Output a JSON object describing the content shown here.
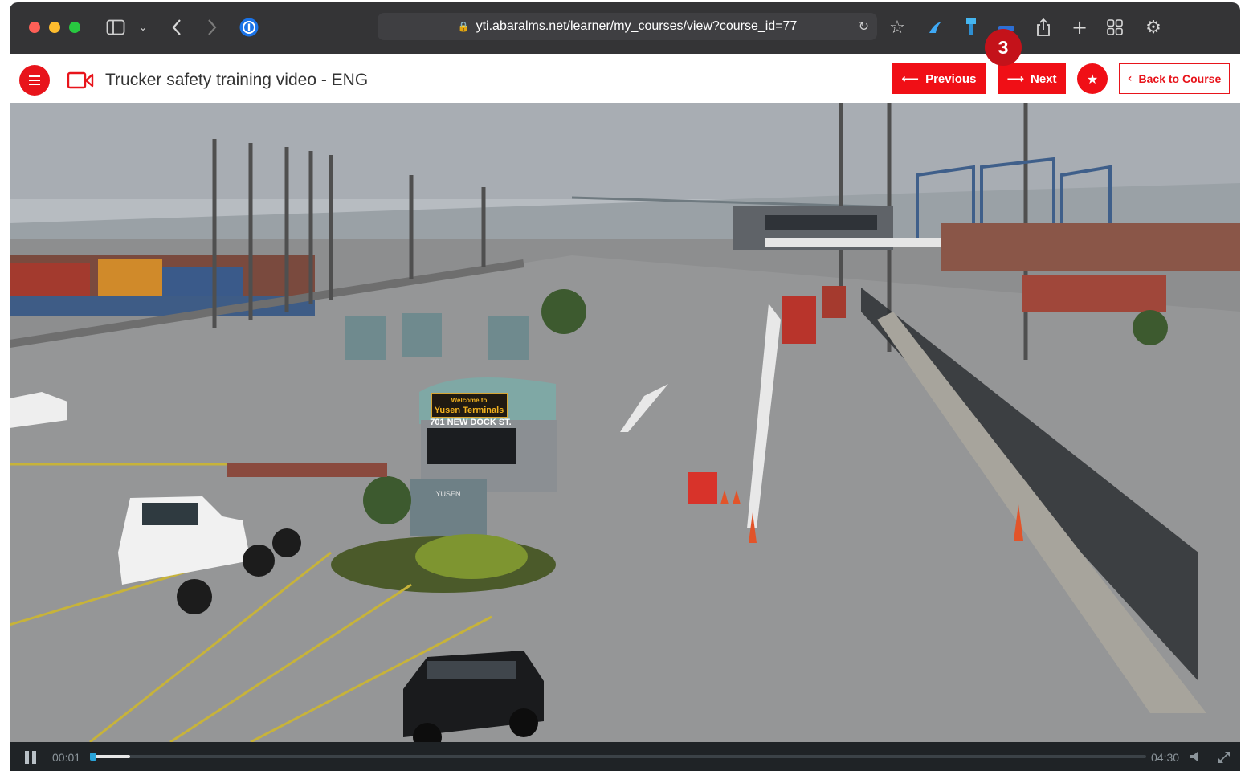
{
  "browser": {
    "url": "yti.abaralms.net/learner/my_courses/view?course_id=77"
  },
  "header": {
    "course_title": "Trucker safety training video - ENG",
    "previous_label": "Previous",
    "next_label": "Next",
    "back_label": "Back to Course",
    "badge_count": "3",
    "accent_color": "#f00f16"
  },
  "player": {
    "elapsed": "00:01",
    "duration": "04:30",
    "progress_fraction": 0.004
  },
  "video_scene": {
    "sign_welcome": "Welcome to",
    "sign_name": "Yusen Terminals",
    "address": "701 NEW DOCK ST.",
    "monument_text": "YUSEN"
  }
}
